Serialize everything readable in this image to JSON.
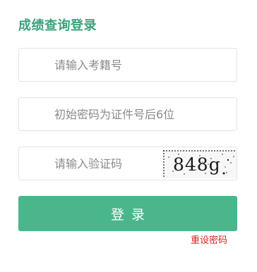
{
  "title": "成绩查询登录",
  "fields": {
    "exam_number": {
      "placeholder": "请输入考籍号",
      "value": ""
    },
    "password": {
      "placeholder": "初始密码为证件号后6位",
      "value": ""
    },
    "captcha": {
      "placeholder": "请输入验证码",
      "value": ""
    }
  },
  "captcha_image": {
    "text": "848g"
  },
  "login_button": {
    "label": "登录"
  },
  "reset_password_link": {
    "label": "重设密码"
  },
  "colors": {
    "accent": "#3aa27a",
    "button": "#4bb58b",
    "link": "#e02020"
  }
}
